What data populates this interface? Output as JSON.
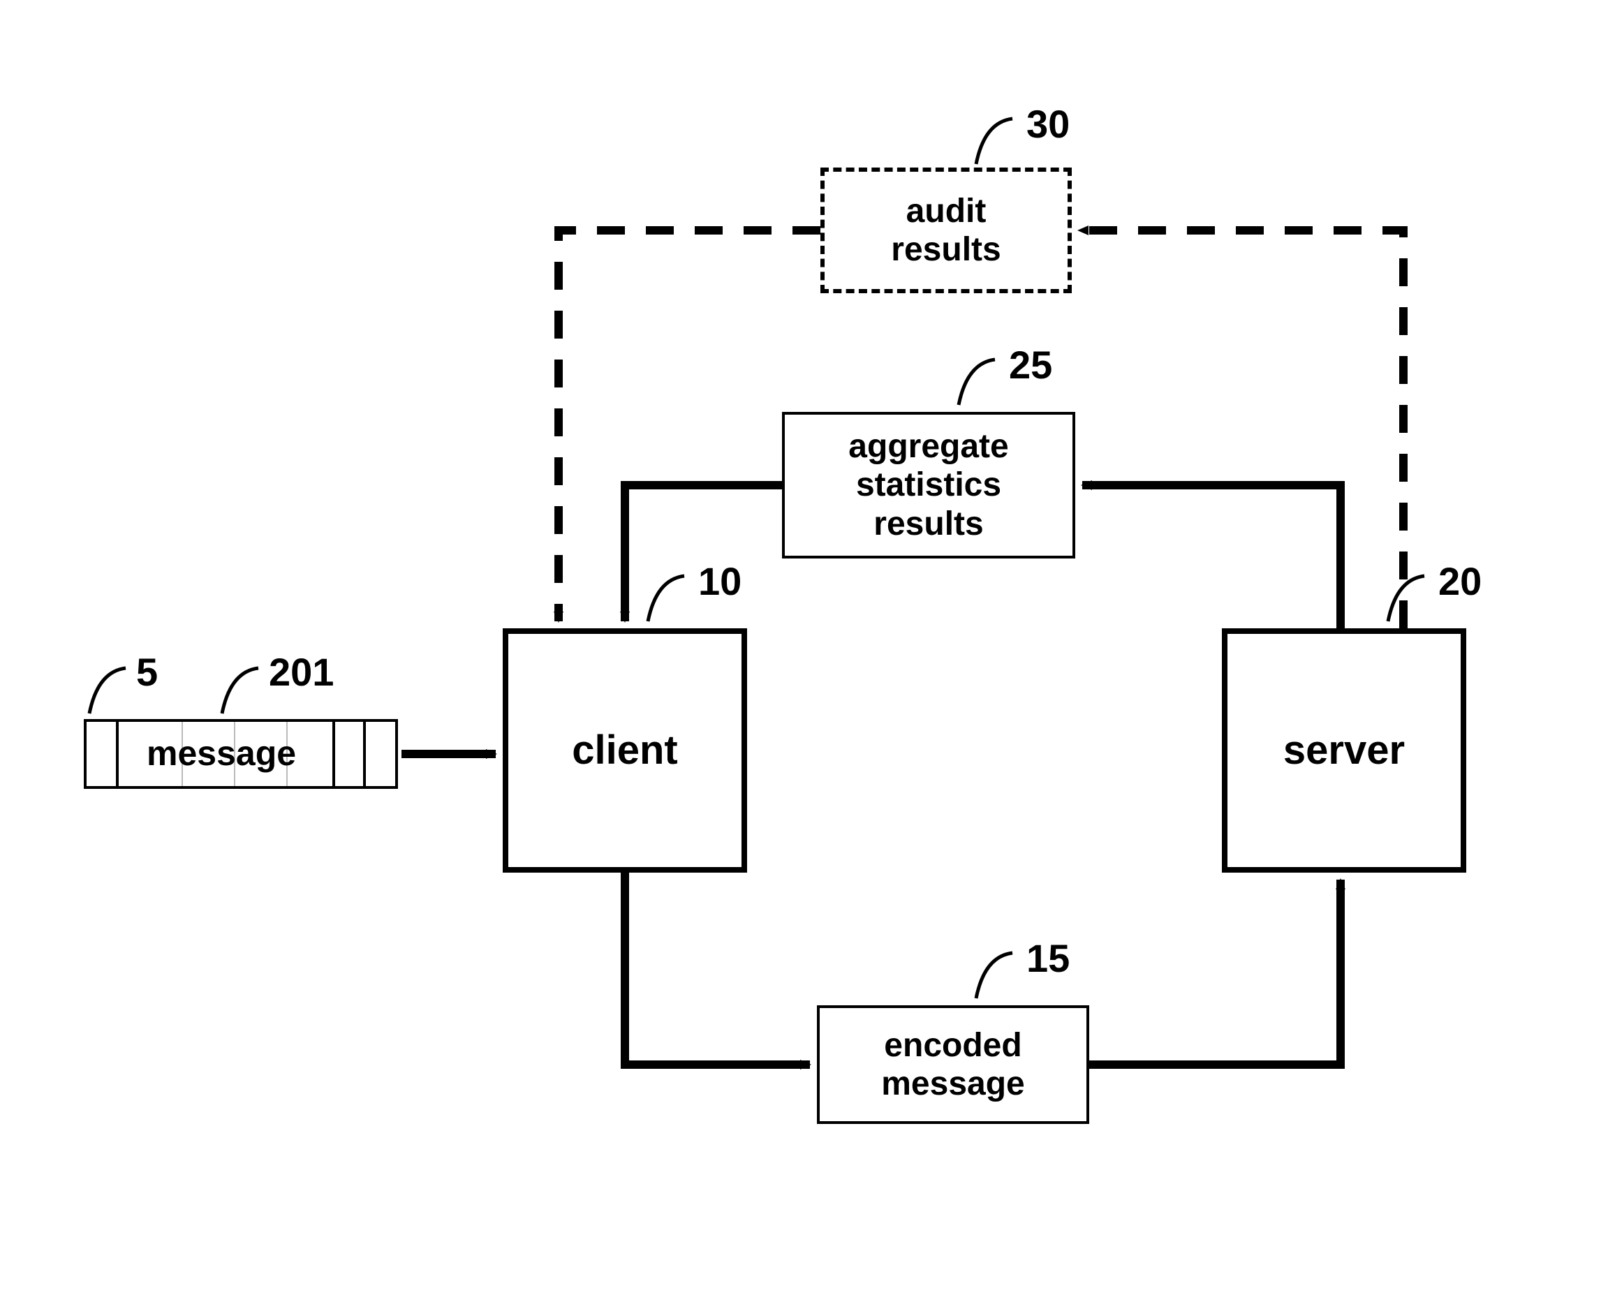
{
  "nodes": {
    "client": {
      "label": "client",
      "ref": "10"
    },
    "server": {
      "label": "server",
      "ref": "20"
    },
    "encoded": {
      "label": "encoded\nmessage",
      "ref": "15"
    },
    "aggregate": {
      "label": "aggregate\nstatistics\nresults",
      "ref": "25"
    },
    "audit": {
      "label": "audit\nresults",
      "ref": "30"
    },
    "message": {
      "label": "message",
      "ref_shape": "5",
      "ref_seg": "201"
    }
  }
}
